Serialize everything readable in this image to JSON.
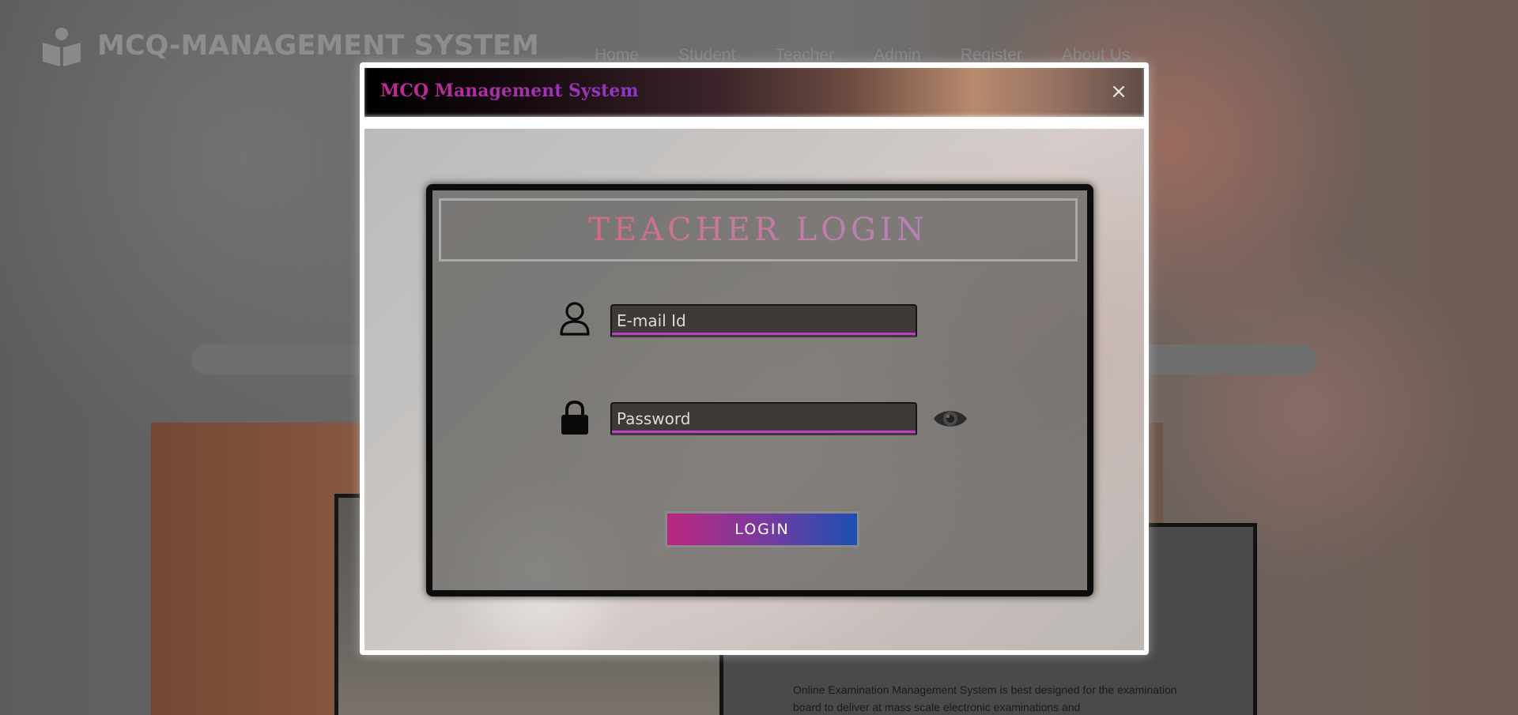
{
  "site": {
    "brand": "MCQ-MANAGEMENT SYSTEM",
    "nav": [
      "Home",
      "Student",
      "Teacher",
      "Admin",
      "Register",
      "About Us"
    ],
    "description": "Online Examination Management System is best designed for the examination board to deliver at mass scale electronic examinations and"
  },
  "modal": {
    "title": "MCQ Management System",
    "close_label": "×"
  },
  "login": {
    "title": "TEACHER LOGIN",
    "email_placeholder": "E-mail Id",
    "password_placeholder": "Password",
    "button_label": "LOGIN"
  },
  "icons": {
    "logo": "reader-logo-icon",
    "user": "user-icon",
    "lock": "lock-icon",
    "eye": "eye-icon"
  }
}
